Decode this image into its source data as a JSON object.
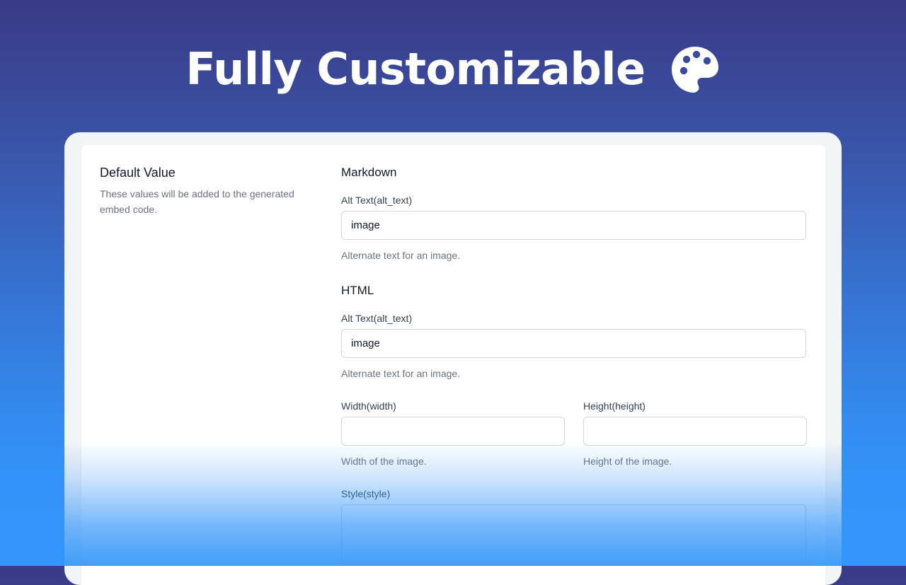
{
  "hero": {
    "title": "Fully Customizable",
    "icon": "palette-icon"
  },
  "settings": {
    "heading": "Default Value",
    "description": "These values will be added to the generated embed code.",
    "markdown": {
      "title": "Markdown",
      "alt_label": "Alt Text(alt_text)",
      "alt_value": "image",
      "alt_help": "Alternate text for an image."
    },
    "html": {
      "title": "HTML",
      "alt_label": "Alt Text(alt_text)",
      "alt_value": "image",
      "alt_help": "Alternate text for an image.",
      "width_label": "Width(width)",
      "width_value": "",
      "width_help": "Width of the image.",
      "height_label": "Height(height)",
      "height_value": "",
      "height_help": "Height of the image.",
      "style_label": "Style(style)",
      "style_value": ""
    }
  },
  "colors": {
    "background_top": "#393a87",
    "background_bottom": "#3395fa",
    "card": "#ffffff",
    "frame": "#f3f4f6",
    "border": "#d1d5db",
    "muted_text": "#6b7280"
  }
}
